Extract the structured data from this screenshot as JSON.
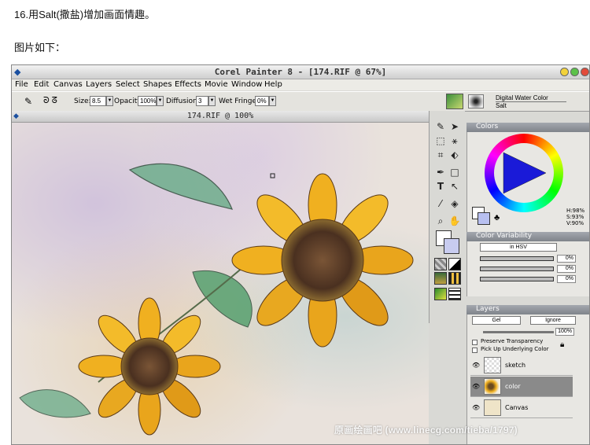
{
  "intro": {
    "step_text": "16.用Salt(撒盐)增加画面情趣。",
    "caption": "图片如下："
  },
  "app": {
    "window_title": "Corel Painter 8 - [174.RIF @ 67%]",
    "menu": [
      "File",
      "Edit",
      "Canvas",
      "Layers",
      "Select",
      "Shapes",
      "Effects",
      "Movie",
      "Window",
      "Help"
    ],
    "property_bar": {
      "size_label": "Size:",
      "size_value": "8.5",
      "opacity_label": "Opacity:",
      "opacity_value": "100%",
      "diffusion_label": "Diffusion:",
      "diffusion_value": "3",
      "wet_fringe_label": "Wet Fringe:",
      "wet_fringe_value": "0%"
    },
    "brush": {
      "category": "Digital Water Color",
      "variant": "Salt"
    },
    "document_title": "174.RIF @ 100%",
    "colors_panel": {
      "title": "Colors",
      "hsv_h": "H:98%",
      "hsv_s": "S:93%",
      "hsv_v": "V:90%"
    },
    "color_variability_panel": {
      "title": "Color Variability",
      "mode": "in HSV",
      "values": [
        "0%",
        "0%",
        "0%"
      ]
    },
    "layers_panel": {
      "title": "Layers",
      "method": "Gel",
      "composite": "Ignore",
      "opacity": "100%",
      "preserve_transparency": "Preserve Transparency",
      "pick_up_underlying": "Pick Up Underlying Color",
      "layers": [
        {
          "name": "sketch"
        },
        {
          "name": "color",
          "selected": true
        },
        {
          "name": "Canvas"
        }
      ]
    },
    "colors": {
      "accent": "#7f848b",
      "selected_layer": "#8a8a8a",
      "canvas_bg": "#e9e2dc"
    }
  },
  "watermark": "原画绘画吧 (www.linecg.com/tieba/1797)"
}
